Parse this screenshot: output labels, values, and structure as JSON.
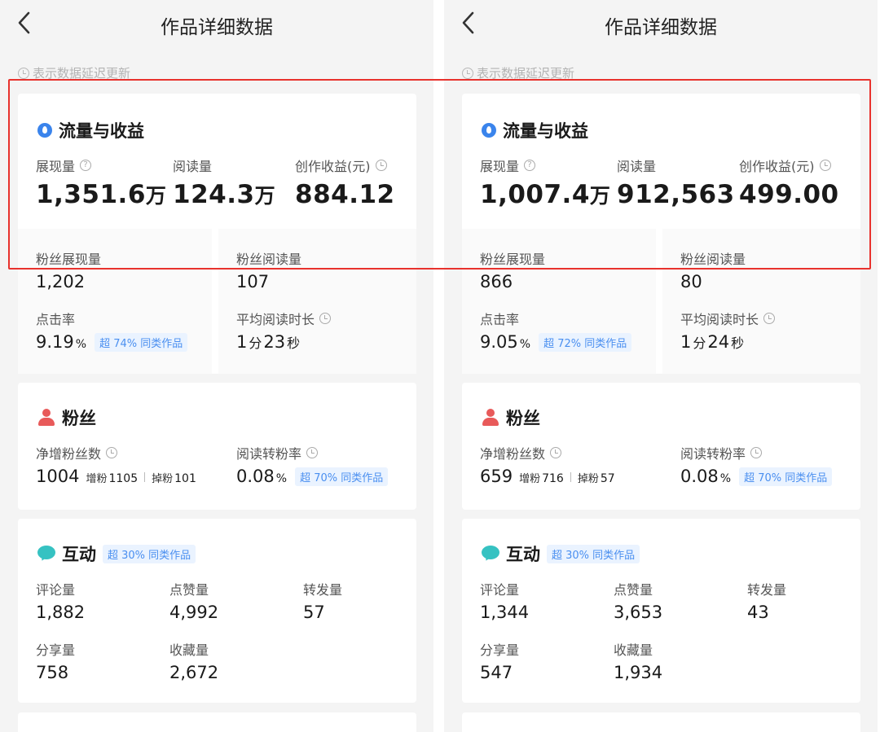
{
  "title": "作品详细数据",
  "notice": "表示数据延迟更新",
  "colors": {
    "highlight": "#e8322d",
    "badge_text": "#4a8ff0",
    "badge_bg": "#eaf3ff",
    "traffic_icon": "#3a84ec",
    "fans_icon": "#e85a5a",
    "interact_icon": "#36c2c2"
  },
  "labels": {
    "traffic_section": "流量与收益",
    "impressions": "展现量",
    "reads": "阅读量",
    "earnings": "创作收益(元)",
    "fan_impressions": "粉丝展现量",
    "fan_reads": "粉丝阅读量",
    "ctr": "点击率",
    "avg_read_time": "平均阅读时长",
    "fans_section": "粉丝",
    "net_fans": "净增粉丝数",
    "gain": "增粉",
    "loss": "掉粉",
    "read_to_fan": "阅读转粉率",
    "interact_section": "互动",
    "comments": "评论量",
    "likes": "点赞量",
    "shares_forward": "转发量",
    "shares": "分享量",
    "favorites": "收藏量",
    "percent_unit": "%",
    "minute_unit": "分",
    "second_unit": "秒"
  },
  "panels": [
    {
      "impressions_num": "1,351.6",
      "impressions_unit": "万",
      "reads_num": "124.3",
      "reads_unit": "万",
      "earnings": "884.12",
      "fan_impressions": "1,202",
      "fan_reads": "107",
      "ctr": "9.19",
      "ctr_badge": "超 74% 同类作品",
      "avg_min": "1",
      "avg_sec": "23",
      "net_fans": "1004",
      "gain": "1105",
      "loss": "101",
      "read_to_fan": "0.08",
      "read_to_fan_badge": "超 70% 同类作品",
      "interact_badge": "超 30% 同类作品",
      "comments": "1,882",
      "likes": "4,992",
      "shares_forward": "57",
      "shares": "758",
      "favorites": "2,672"
    },
    {
      "impressions_num": "1,007.4",
      "impressions_unit": "万",
      "reads_num": "912,563",
      "reads_unit": "",
      "earnings": "499.00",
      "fan_impressions": "866",
      "fan_reads": "80",
      "ctr": "9.05",
      "ctr_badge": "超 72% 同类作品",
      "avg_min": "1",
      "avg_sec": "24",
      "net_fans": "659",
      "gain": "716",
      "loss": "57",
      "read_to_fan": "0.08",
      "read_to_fan_badge": "超 70% 同类作品",
      "interact_badge": "超 30% 同类作品",
      "comments": "1,344",
      "likes": "3,653",
      "shares_forward": "43",
      "shares": "547",
      "favorites": "1,934"
    }
  ]
}
